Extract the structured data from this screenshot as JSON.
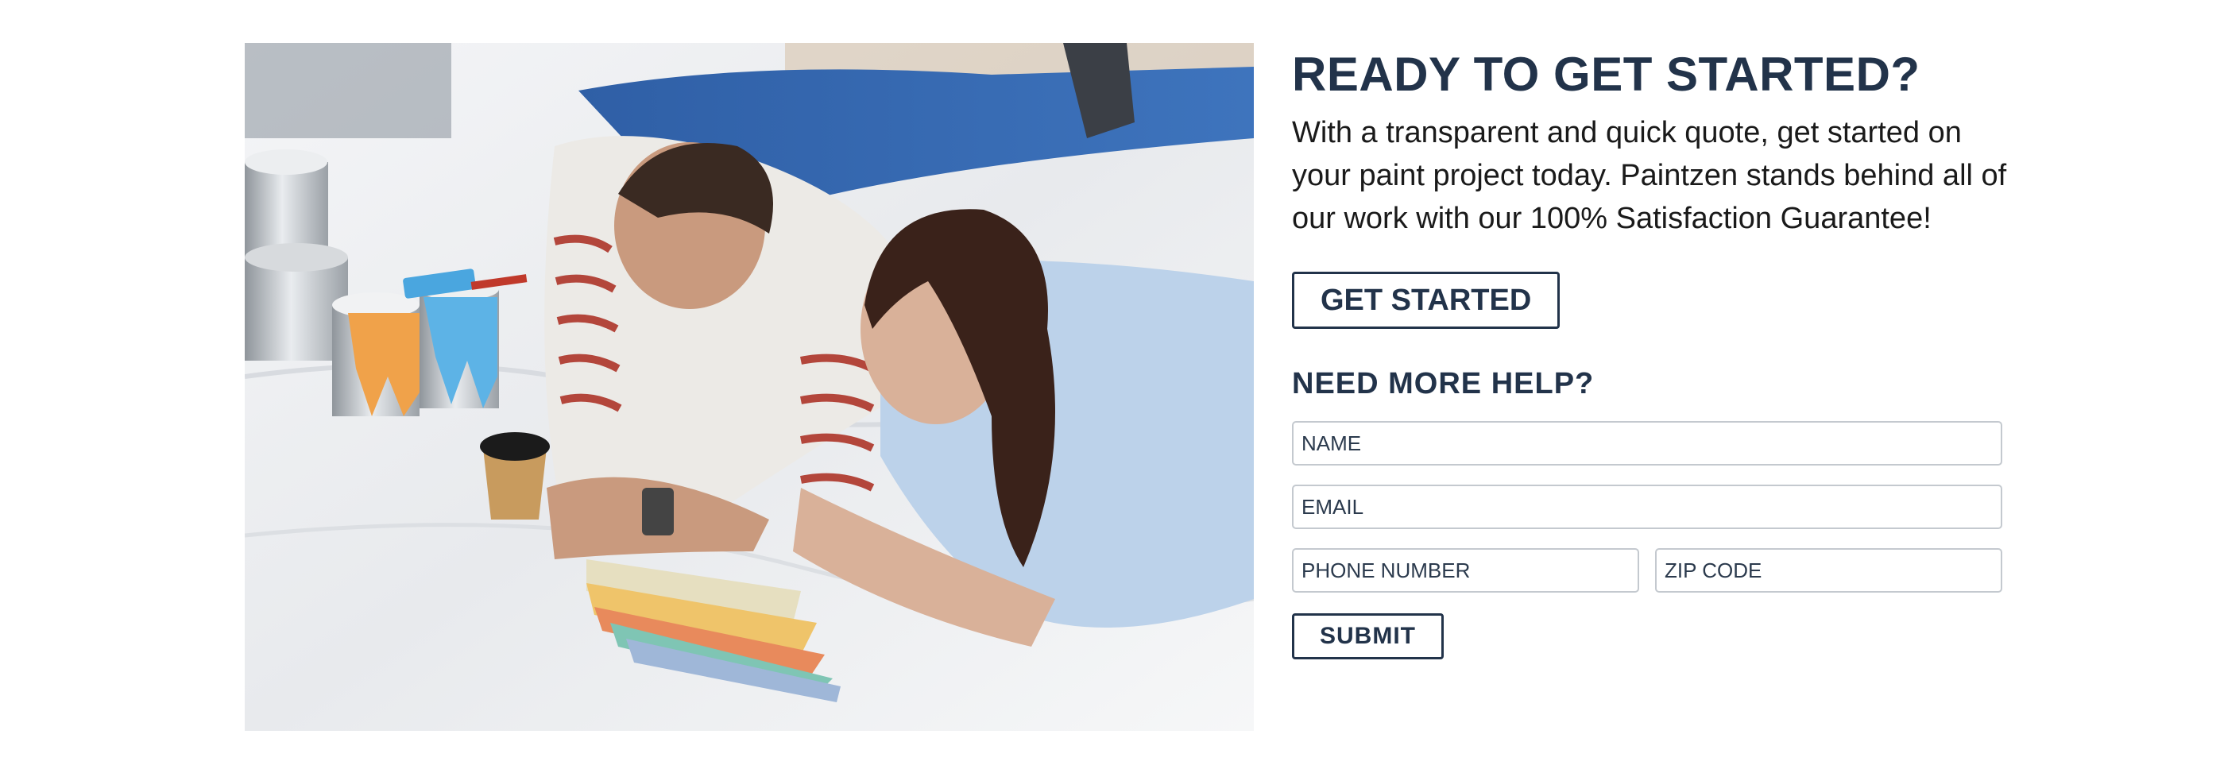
{
  "cta": {
    "headline": "READY TO GET STARTED?",
    "body": "With a transparent and quick quote, get started on your paint project today. Paintzen stands behind all of our work with our 100% Satisfaction Guarantee!",
    "button_label": "GET STARTED"
  },
  "help": {
    "title": "NEED MORE HELP?",
    "fields": {
      "name_placeholder": "NAME",
      "email_placeholder": "EMAIL",
      "phone_placeholder": "PHONE NUMBER",
      "zip_placeholder": "ZIP CODE"
    },
    "submit_label": "SUBMIT"
  },
  "photo": {
    "subject": "couple-choosing-paint-colors-photo"
  },
  "colors": {
    "brand_navy": "#22334a",
    "field_border": "#c4c9cf"
  }
}
